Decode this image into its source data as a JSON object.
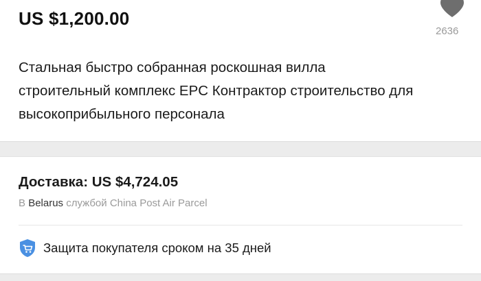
{
  "product": {
    "price": "US $1,200.00",
    "wishlist_count": "2636",
    "title_lines": [
      "Стальная быстро собранная роскошная вилла",
      "строительный комплекс EPC Контрактор строительство для",
      "высокоприбыльного персонала"
    ]
  },
  "shipping": {
    "title": "Доставка: US $4,724.05",
    "prefix": "В",
    "country": "Belarus",
    "middle": "службой",
    "carrier": "China Post Air Parcel"
  },
  "protection": {
    "label": "Защита покупателя сроком на 35 дней"
  },
  "icons": {
    "wishlist": "heart-icon",
    "protection": "shield-cart-icon"
  },
  "colors": {
    "text_primary": "#111111",
    "text_secondary": "#9a9a9a",
    "heart": "#6e6e6e",
    "shield": "#4a90e2",
    "separator": "#ececec"
  }
}
